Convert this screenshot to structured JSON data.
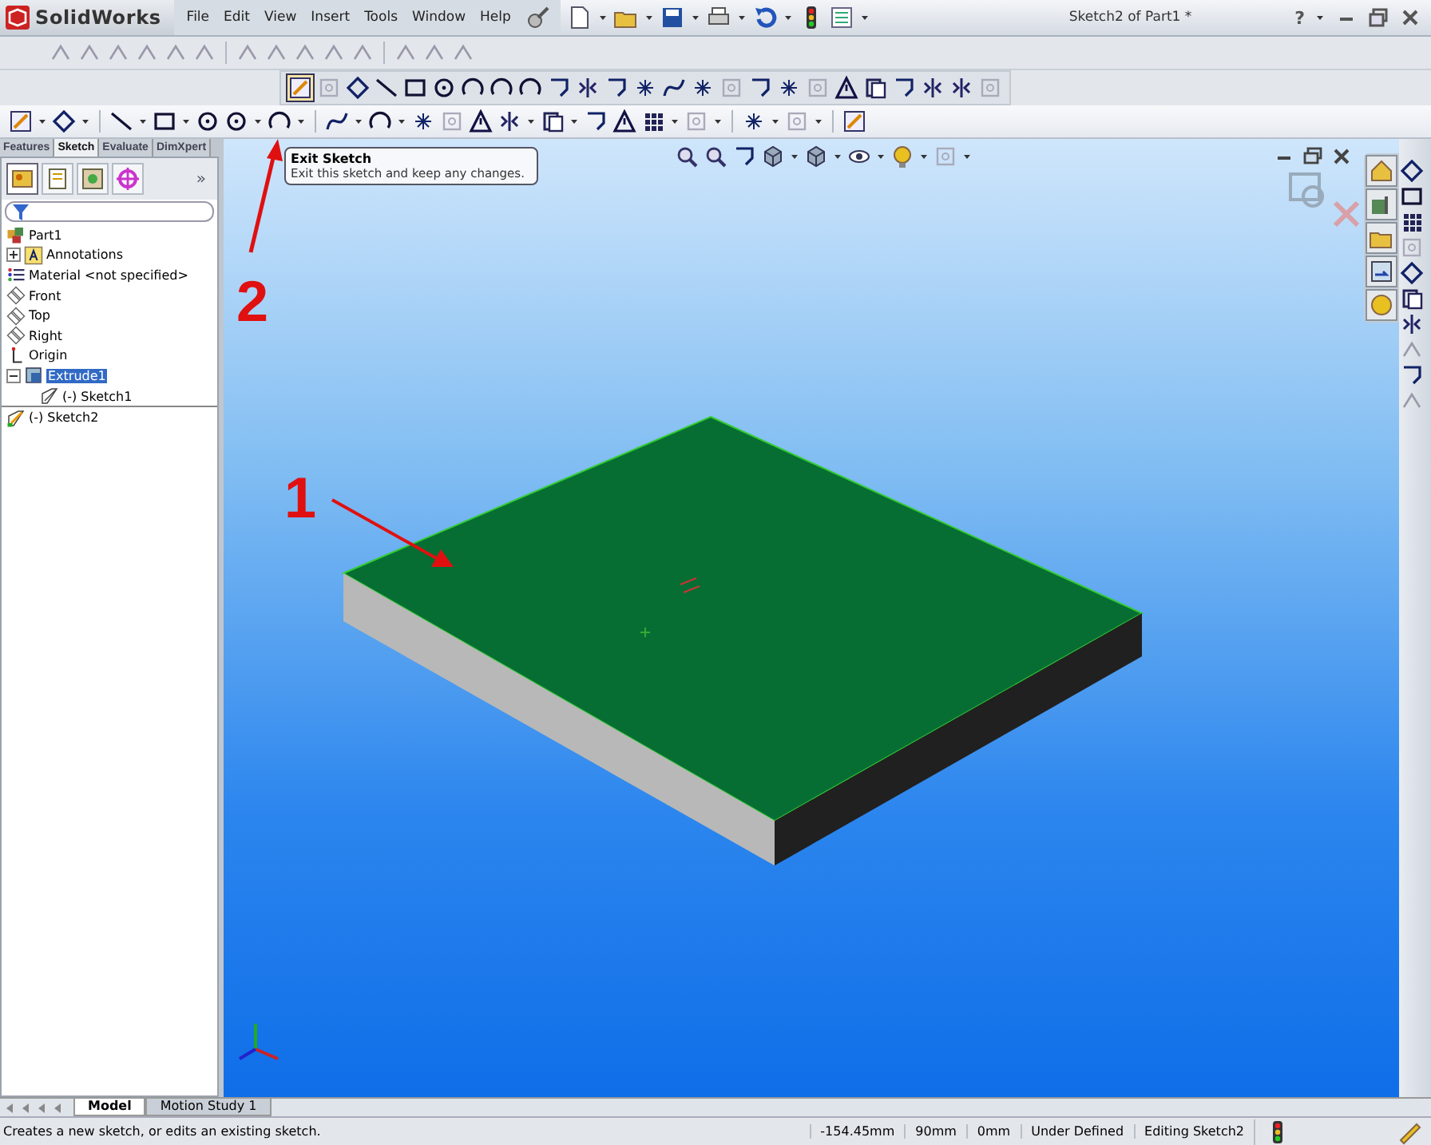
{
  "app": {
    "logo": "SolidWorks",
    "title": "Sketch2 of Part1 *",
    "help": "?"
  },
  "menu": [
    {
      "label": "File"
    },
    {
      "label": "Edit"
    },
    {
      "label": "View"
    },
    {
      "label": "Insert"
    },
    {
      "label": "Tools"
    },
    {
      "label": "Window"
    },
    {
      "label": "Help"
    }
  ],
  "command_tabs": [
    {
      "label": "Features",
      "selected": false
    },
    {
      "label": "Sketch",
      "selected": true
    },
    {
      "label": "Evaluate",
      "selected": false
    },
    {
      "label": "DimXpert",
      "selected": false
    }
  ],
  "tooltip": {
    "title": "Exit Sketch",
    "text": "Exit this sketch and keep any changes."
  },
  "panel_tabs": [
    {
      "selected": true
    },
    {
      "selected": false
    },
    {
      "selected": false
    },
    {
      "selected": false
    }
  ],
  "panel_expand": "»",
  "tree": [
    {
      "label": "Part1",
      "kind": "part",
      "children": [
        {
          "label": "Annotations",
          "kind": "annotation",
          "expanded": false,
          "selected": false
        },
        {
          "label": "Material <not specified>",
          "kind": "material"
        },
        {
          "label": "Front",
          "kind": "plane"
        },
        {
          "label": "Top",
          "kind": "plane"
        },
        {
          "label": "Right",
          "kind": "plane"
        },
        {
          "label": "Origin",
          "kind": "origin"
        },
        {
          "label": "Extrude1",
          "kind": "extrude",
          "expanded": true,
          "selected": true,
          "children": [
            {
              "label": "(-) Sketch1",
              "kind": "sketch"
            }
          ]
        },
        {
          "label": "(-) Sketch2",
          "kind": "sketch2"
        }
      ]
    }
  ],
  "annotations": [
    {
      "label": "1"
    },
    {
      "label": "2"
    }
  ],
  "bottom_tabs": [
    {
      "label": "Model",
      "selected": true
    },
    {
      "label": "Motion Study 1",
      "selected": false
    }
  ],
  "status_bar": {
    "message": "Creates a new sketch, or edits an existing sketch.",
    "x": "-154.45mm",
    "y": "90mm",
    "z": "0mm",
    "state": "Under Defined",
    "editing": "Editing Sketch2"
  }
}
